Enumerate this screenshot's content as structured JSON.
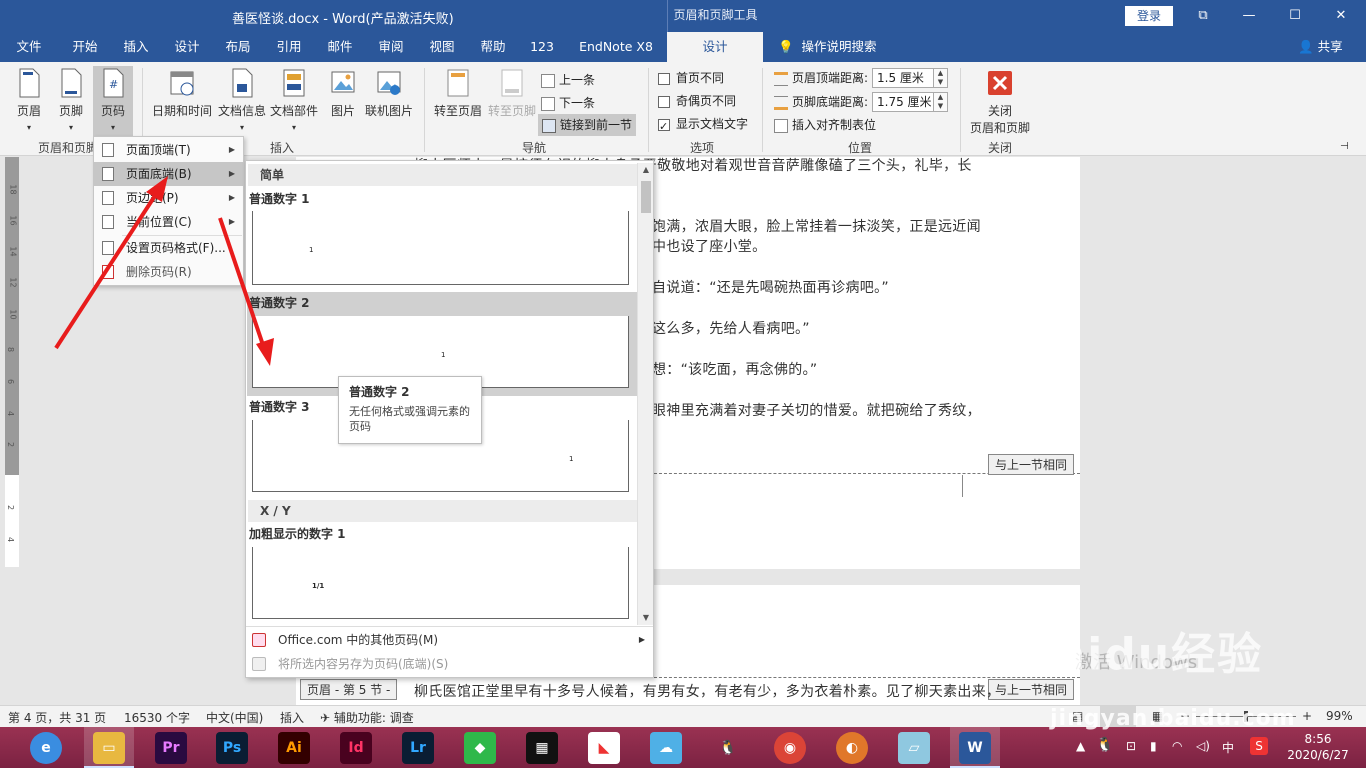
{
  "titlebar": {
    "doc_title": "善医怪谈.docx  -  Word(产品激活失败)",
    "tools_title": "页眉和页脚工具",
    "login": "登录",
    "restore": "⧉",
    "minimize": "—",
    "maximize": "☐",
    "close": "✕"
  },
  "tabs": [
    "文件",
    "开始",
    "插入",
    "设计",
    "布局",
    "引用",
    "邮件",
    "审阅",
    "视图",
    "帮助",
    "123",
    "EndNote X8",
    "设计"
  ],
  "search_label": "操作说明搜索",
  "share_label": "共享",
  "ribbon": {
    "header": "页眉",
    "footer": "页脚",
    "page_number": "页码",
    "group_hf": "页眉和页脚",
    "date_time": "日期和时间",
    "doc_info": "文档信息",
    "doc_parts": "文档部件",
    "picture": "图片",
    "online_picture": "联机图片",
    "group_insert": "插入",
    "goto_header": "转至页眉",
    "goto_footer": "转至页脚",
    "prev": "上一条",
    "next": "下一条",
    "link_prev": "链接到前一节",
    "group_nav": "导航",
    "first_diff": "首页不同",
    "odd_even_diff": "奇偶页不同",
    "show_doc_text": "显示文档文字",
    "group_options": "选项",
    "header_top_label": "页眉顶端距离:",
    "header_top_value": "1.5 厘米",
    "footer_bottom_label": "页脚底端距离:",
    "footer_bottom_value": "1.75 厘米",
    "insert_align_tab": "插入对齐制表位",
    "group_position": "位置",
    "close_hf_line1": "关闭",
    "close_hf_line2": "页眉和页脚",
    "group_close": "关闭"
  },
  "menu": {
    "items": [
      {
        "label": "页面顶端(T)",
        "submenu": true
      },
      {
        "label": "页面底端(B)",
        "submenu": true
      },
      {
        "label": "页边距(P)",
        "submenu": true
      },
      {
        "label": "当前位置(C)",
        "submenu": true
      },
      {
        "label": "设置页码格式(F)...",
        "submenu": false
      },
      {
        "label": "删除页码(R)",
        "submenu": false
      }
    ]
  },
  "gallery": {
    "section1": "简单",
    "item1": "普通数字 1",
    "item2": "普通数字 2",
    "item3": "普通数字 3",
    "section2": "X / Y",
    "item4": "加粗显示的数字 1",
    "thumb_num": "1",
    "thumb_num_xy": "1/1",
    "more_label": "Office.com 中的其他页码(M)",
    "save_label": "将所选内容另存为页码(底端)(S)"
  },
  "tooltip": {
    "title": "普通数字 2",
    "desc": "无任何格式或强调元素的页码"
  },
  "document": {
    "line1": "柳大医师中，是按须在视的柳大身承严敬敬地对着观世音音萨雕像磕了三个头，礼毕，长",
    "line2": "饱满，浓眉大眼，脸上常挂着一抹淡笑，正是远近闻",
    "line3": "中也设了座小堂。",
    "line4": "自说道：“还是先喝碗热面再诊病吧。”",
    "line5": "这么多，先给人看病吧。”",
    "line6": "想：“该吃面，再念佛的。”",
    "line7": "眼神里充满着对妻子关切的惜爱。就把碗给了秀纹，",
    "same_prev_1": "与上一节相同",
    "footer_tag": "页眉 - 第 5 节 -",
    "line8": "柳氏医馆正堂里早有十多号人候着，有男有女，有老有少，多为衣着朴素。见了柳天素出来，",
    "same_prev_2": "与上一节相同",
    "activate": "激活 Windows"
  },
  "ruler_ticks": [
    "18",
    "16",
    "14",
    "12",
    "10",
    "8",
    "6",
    "4",
    "2",
    "2",
    "4"
  ],
  "status": {
    "page": "第 4 页，共 31 页",
    "words": "16530 个字",
    "lang": "中文(中国)",
    "mode": "插入",
    "accessibility": "辅助功能: 调查",
    "zoom": "99%"
  },
  "taskbar": {
    "ime": "中",
    "time": "8:56",
    "date": "2020/6/27"
  },
  "watermark": {
    "logo": "Baidu经验",
    "url": "jingyan.baidu.com"
  }
}
